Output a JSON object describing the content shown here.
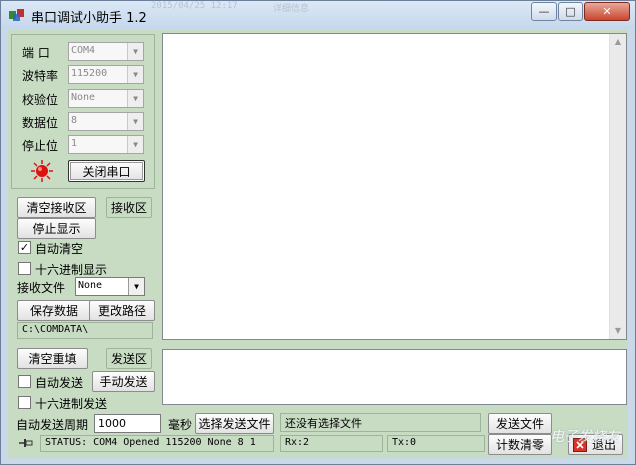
{
  "window": {
    "title": "串口调试小助手 1.2",
    "faint_tab_1": "2015/04/25 12:17",
    "faint_tab_2": "详细信息",
    "minimize": "—",
    "maximize": "□",
    "close": "✕"
  },
  "settings": {
    "port_label": "端  口",
    "port_value": "COM4",
    "baud_label": "波特率",
    "baud_value": "115200",
    "parity_label": "校验位",
    "parity_value": "None",
    "databits_label": "数据位",
    "databits_value": "8",
    "stopbits_label": "停止位",
    "stopbits_value": "1",
    "close_port_label": "关闭串口",
    "led_color": "#e01010"
  },
  "receive": {
    "clear_label": "清空接收区",
    "area_label": "接收区",
    "stop_display_label": "停止显示",
    "auto_clear_label": "自动清空",
    "auto_clear_checked": true,
    "hex_display_label": "十六进制显示",
    "hex_display_checked": false,
    "file_label": "接收文件",
    "file_value": "None",
    "save_label": "保存数据",
    "change_path_label": "更改路径",
    "path_value": "C:\\COMDATA\\"
  },
  "send": {
    "clear_resend_label": "清空重填",
    "area_label": "发送区",
    "auto_send_label": "自动发送",
    "auto_send_checked": false,
    "manual_send_label": "手动发送",
    "hex_send_label": "十六进制发送",
    "hex_send_checked": false,
    "period_label": "自动发送周期",
    "period_value": "1000",
    "period_unit": "毫秒",
    "select_file_label": "选择发送文件",
    "file_status": "还没有选择文件",
    "send_file_label": "发送文件",
    "clear_count_label": "计数清零",
    "exit_label": "退出"
  },
  "status": {
    "text": "STATUS: COM4 Opened 115200 None 8 1",
    "rx": "Rx:2",
    "tx": "Tx:0"
  },
  "watermark": "电子发烧友"
}
